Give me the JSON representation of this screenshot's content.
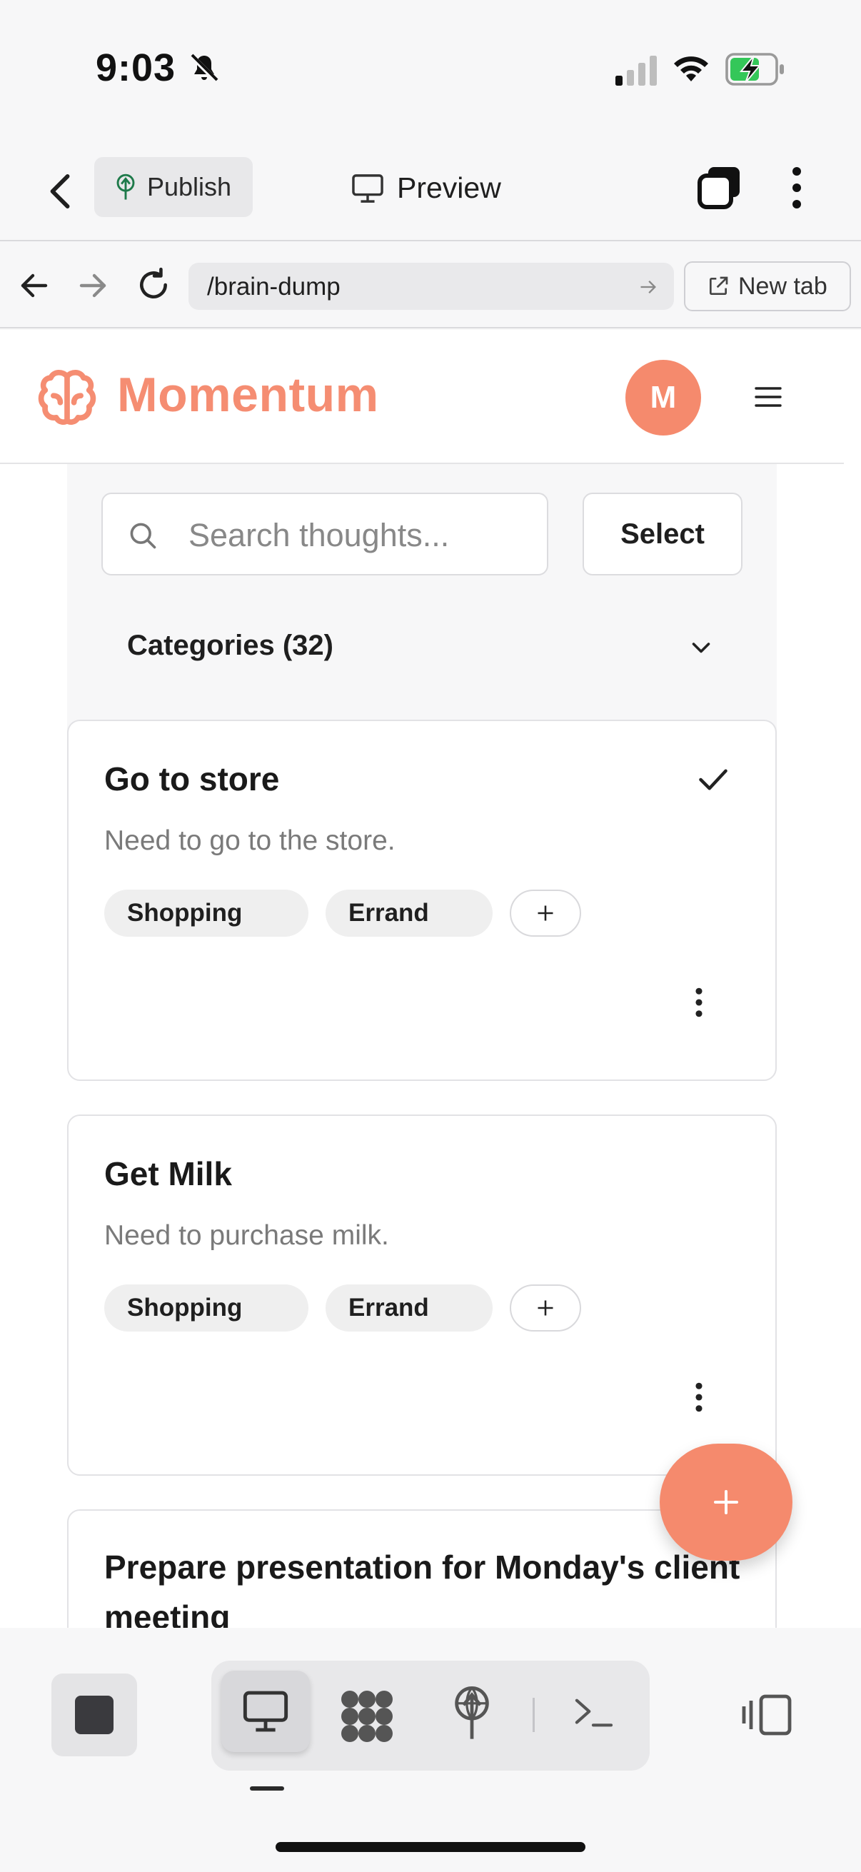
{
  "status_bar": {
    "time": "9:03",
    "icons": [
      "bell-slash-icon",
      "signal-icon",
      "wifi-icon",
      "battery-charging-icon"
    ]
  },
  "toolbar": {
    "publish_label": "Publish",
    "preview_label": "Preview"
  },
  "browser": {
    "url": "/brain-dump",
    "new_tab_label": "New tab"
  },
  "site": {
    "brand": "Momentum",
    "avatar_initial": "M",
    "accent_color": "#f58a6d"
  },
  "filters": {
    "search_placeholder": "Search thoughts...",
    "select_label": "Select",
    "categories_label": "Categories (32)"
  },
  "cards": [
    {
      "title": "Go to store",
      "description": "Need to go to the store.",
      "tags": [
        "Shopping",
        "Errand"
      ],
      "completed": true
    },
    {
      "title": "Get Milk",
      "description": "Need to purchase milk.",
      "tags": [
        "Shopping",
        "Errand"
      ],
      "completed": false
    },
    {
      "title": "Prepare presentation for Monday's client meeting",
      "description": "",
      "tags": [],
      "completed": false
    }
  ],
  "bottom_bar": {
    "tools": [
      "desktop-icon",
      "apps-icon",
      "publish-icon",
      "terminal-icon"
    ],
    "active_tool": "desktop"
  }
}
